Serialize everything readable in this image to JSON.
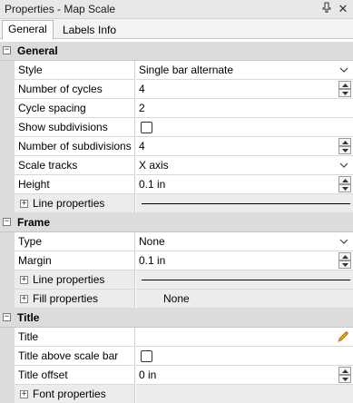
{
  "window": {
    "title": "Properties - Map Scale",
    "pin_icon": "pin-icon",
    "close_icon": "close-icon"
  },
  "tabs": [
    {
      "label": "General",
      "active": true
    },
    {
      "label": "Labels",
      "active": false
    },
    {
      "label": "Info",
      "active": false
    }
  ],
  "sections": {
    "general": {
      "label": "General",
      "style": {
        "name": "Style",
        "value": "Single bar alternate"
      },
      "cycles": {
        "name": "Number of cycles",
        "value": "4"
      },
      "spacing": {
        "name": "Cycle spacing",
        "value": "2"
      },
      "show_sub": {
        "name": "Show subdivisions",
        "checked": false
      },
      "num_sub": {
        "name": "Number of subdivisions",
        "value": "4"
      },
      "tracks": {
        "name": "Scale tracks",
        "value": "X axis"
      },
      "height": {
        "name": "Height",
        "value": "0.1 in"
      },
      "line_props": {
        "name": "Line properties"
      }
    },
    "frame": {
      "label": "Frame",
      "type": {
        "name": "Type",
        "value": "None"
      },
      "margin": {
        "name": "Margin",
        "value": "0.1 in"
      },
      "line_props": {
        "name": "Line properties"
      },
      "fill_props": {
        "name": "Fill properties",
        "value": "None"
      }
    },
    "title": {
      "label": "Title",
      "title": {
        "name": "Title",
        "value": ""
      },
      "above": {
        "name": "Title above scale bar",
        "checked": false
      },
      "offset": {
        "name": "Title offset",
        "value": "0 in"
      },
      "font_props": {
        "name": "Font properties"
      }
    }
  },
  "colors": {
    "category_bg": "#dcdcdc",
    "sub_row_bg": "#ececec",
    "pencil": "#e8a317"
  }
}
